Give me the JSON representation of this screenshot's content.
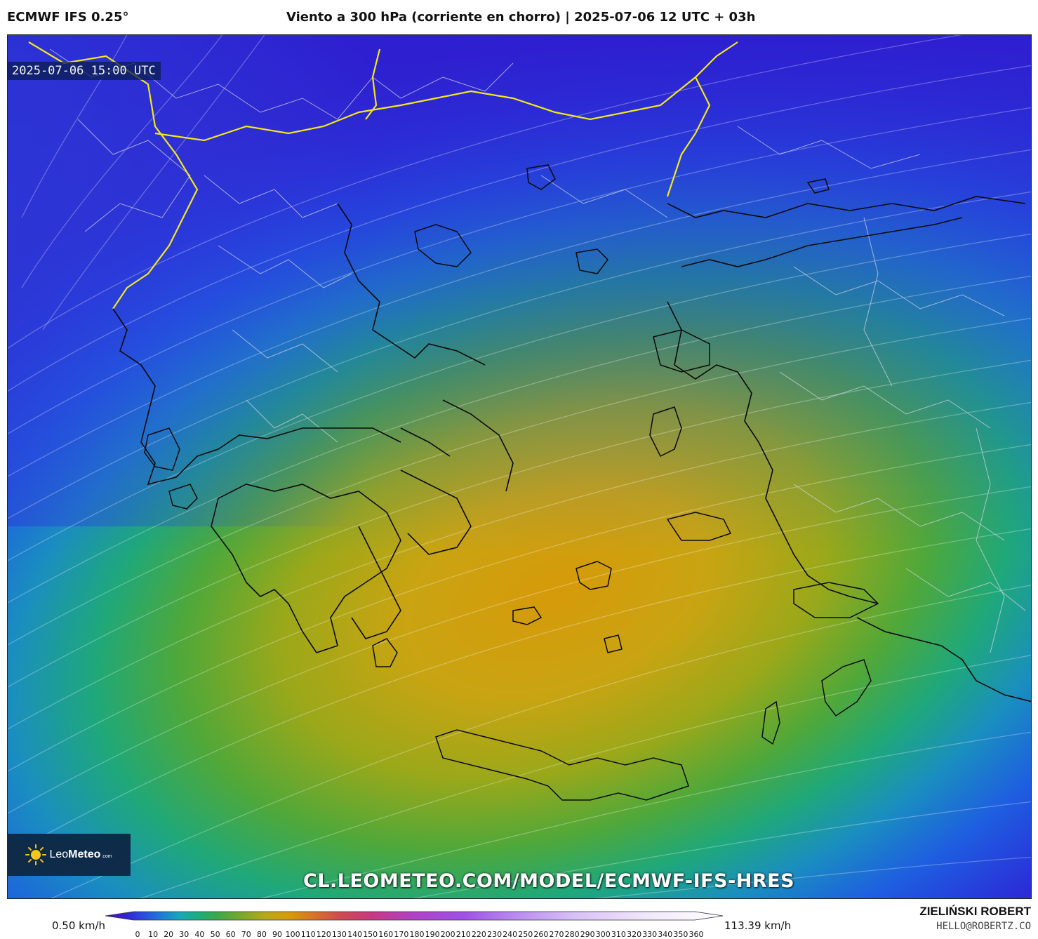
{
  "header": {
    "model": "ECMWF IFS 0.25°",
    "title": "Viento a 300 hPa (corriente en chorro) | 2025-07-06 12 UTC + 03h"
  },
  "map": {
    "valid_time": "2025-07-06 15:00 UTC",
    "url": "CL.LEOMETEO.COM/MODEL/ECMWF-IFS-HRES",
    "logo": {
      "name": "Leo",
      "bold": "Meteo",
      "suffix": ".com"
    }
  },
  "colorbar": {
    "min_label": "0.50 km/h",
    "max_label": "113.39 km/h",
    "ticks": [
      "0",
      "10",
      "20",
      "30",
      "40",
      "50",
      "60",
      "70",
      "80",
      "90",
      "100",
      "110",
      "120",
      "130",
      "140",
      "150",
      "160",
      "170",
      "180",
      "190",
      "200",
      "210",
      "220",
      "230",
      "240",
      "250",
      "260",
      "270",
      "280",
      "290",
      "300",
      "310",
      "320",
      "330",
      "340",
      "350",
      "360"
    ]
  },
  "footer": {
    "author": "ZIELIŃSKI ROBERT",
    "email": "HELLO@ROBERTZ.CO"
  }
}
